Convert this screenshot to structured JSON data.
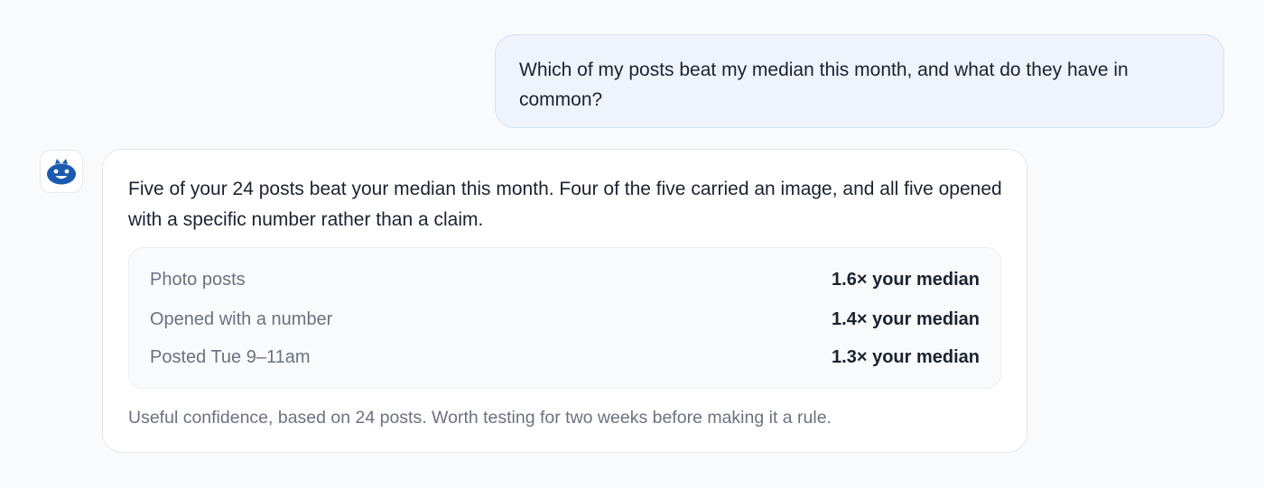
{
  "user_message": {
    "text": "Which of my posts beat my median this month, and what do they have in common?"
  },
  "assistant_avatar": {
    "icon": "bot-face-icon",
    "color": "#1a5bb0"
  },
  "assistant_message": {
    "answer": "Five of your 24 posts beat your median this month. Four of the five carried an image, and all five opened with a specific number rather than a claim.",
    "stats": [
      {
        "label": "Photo posts",
        "value": "1.6× your median"
      },
      {
        "label": "Opened with a number",
        "value": "1.4× your median"
      },
      {
        "label": "Posted Tue 9–11am",
        "value": "1.3× your median"
      }
    ],
    "footnote": "Useful confidence, based on 24 posts. Worth testing for two weeks before making it a rule."
  }
}
